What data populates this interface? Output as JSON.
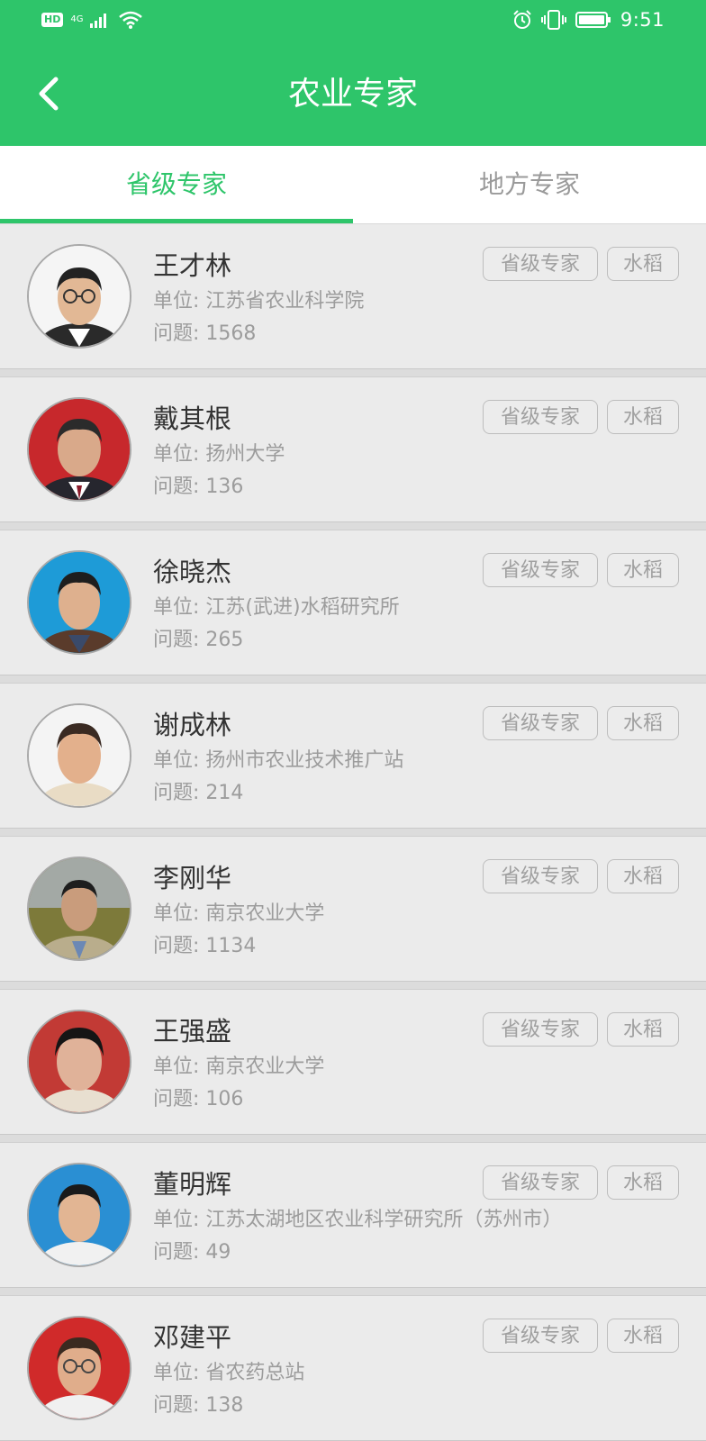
{
  "status_bar": {
    "hd": "HD",
    "network": "4G",
    "time": "9:51"
  },
  "header": {
    "title": "农业专家"
  },
  "tabs": [
    {
      "label": "省级专家",
      "active": true
    },
    {
      "label": "地方专家",
      "active": false
    }
  ],
  "experts": [
    {
      "name": "王才林",
      "unit": "单位: 江苏省农业科学院",
      "questions": "问题: 1568",
      "level_tag": "省级专家",
      "crop_tag": "水稻",
      "avatar_bg": "#f5f5f5",
      "avatar_icon": "portrait-glasses"
    },
    {
      "name": "戴其根",
      "unit": "单位: 扬州大学",
      "questions": "问题: 136",
      "level_tag": "省级专家",
      "crop_tag": "水稻",
      "avatar_bg": "#c7282c",
      "avatar_icon": "portrait"
    },
    {
      "name": "徐晓杰",
      "unit": "单位: 江苏(武进)水稻研究所",
      "questions": "问题: 265",
      "level_tag": "省级专家",
      "crop_tag": "水稻",
      "avatar_bg": "#1e9bd7",
      "avatar_icon": "portrait"
    },
    {
      "name": "谢成林",
      "unit": "单位: 扬州市农业技术推广站",
      "questions": "问题: 214",
      "level_tag": "省级专家",
      "crop_tag": "水稻",
      "avatar_bg": "#f4f4f4",
      "avatar_icon": "portrait"
    },
    {
      "name": "李刚华",
      "unit": "单位: 南京农业大学",
      "questions": "问题: 1134",
      "level_tag": "省级专家",
      "crop_tag": "水稻",
      "avatar_bg": "#8a8f55",
      "avatar_icon": "portrait"
    },
    {
      "name": "王强盛",
      "unit": "单位: 南京农业大学",
      "questions": "问题: 106",
      "level_tag": "省级专家",
      "crop_tag": "水稻",
      "avatar_bg": "#c23a35",
      "avatar_icon": "portrait"
    },
    {
      "name": "董明辉",
      "unit": "单位: 江苏太湖地区农业科学研究所（苏州市）",
      "questions": "问题: 49",
      "level_tag": "省级专家",
      "crop_tag": "水稻",
      "avatar_bg": "#2a8fd3",
      "avatar_icon": "portrait"
    },
    {
      "name": "邓建平",
      "unit": "单位: 省农药总站",
      "questions": "问题: 138",
      "level_tag": "省级专家",
      "crop_tag": "水稻",
      "avatar_bg": "#d02a2a",
      "avatar_icon": "portrait-glasses"
    }
  ],
  "colors": {
    "brand": "#2ec56a",
    "text_primary": "#333333",
    "text_secondary": "#9c9c9c"
  }
}
